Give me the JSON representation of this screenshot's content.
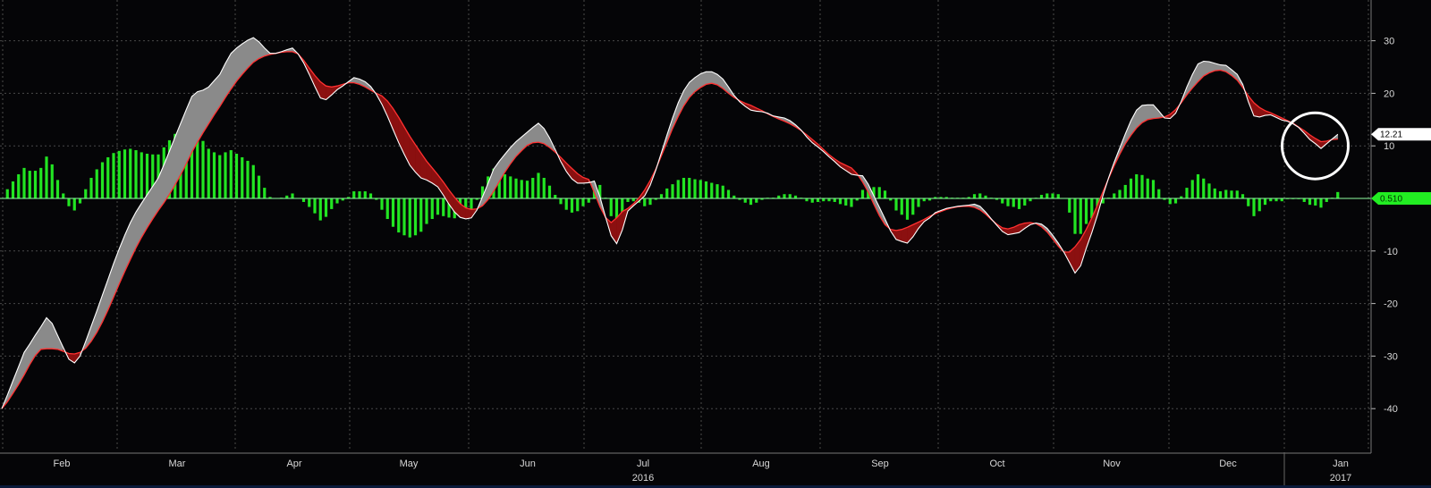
{
  "chart_data": {
    "type": "line",
    "title": "",
    "xlabel": "",
    "ylabel": "",
    "ylim": [
      -48,
      38
    ],
    "grid": true,
    "y_ticks": [
      30,
      20,
      10,
      -10,
      -20,
      -30,
      -40
    ],
    "months": [
      "Feb",
      "Mar",
      "Apr",
      "May",
      "Jun",
      "Jul",
      "Aug",
      "Sep",
      "Oct",
      "Nov",
      "Dec",
      "Jan"
    ],
    "years": [
      {
        "label": "2016",
        "month_index": 5
      },
      {
        "label": "2017",
        "month_index": 11
      }
    ],
    "last_value_tags": [
      {
        "label": "12.21",
        "value": 12.21,
        "color": "#ffffff",
        "text_color": "#000000"
      },
      {
        "label": "0.510",
        "value": 0,
        "color": "#22ee22",
        "text_color": "#003300"
      }
    ],
    "colors": {
      "fast_line": "#ffffff",
      "slow_line": "#ff3030",
      "fill_up": "#8a8a8a",
      "fill_down": "#8b1010",
      "histogram": "#22e522",
      "grid": "#4a4a4a",
      "axis_text": "#d8d8d8",
      "annotation_circle": "#ffffff"
    },
    "annotation": {
      "shape": "circle",
      "x_index": 234,
      "value": 10
    },
    "series": [
      {
        "role": "fast",
        "values": [
          -40.0,
          -37.4,
          -34.7,
          -32.0,
          -29.3,
          -27.7,
          -26.0,
          -24.4,
          -22.7,
          -23.8,
          -26.1,
          -28.4,
          -30.6,
          -31.3,
          -30.0,
          -27.2,
          -24.3,
          -21.4,
          -18.4,
          -15.4,
          -12.4,
          -9.6,
          -7.0,
          -4.6,
          -2.6,
          -0.9,
          0.7,
          2.3,
          3.9,
          6.4,
          9.0,
          11.7,
          14.3,
          16.9,
          19.4,
          20.3,
          20.6,
          21.2,
          22.4,
          23.6,
          25.7,
          27.6,
          28.6,
          29.4,
          30.1,
          30.6,
          29.8,
          28.6,
          27.6,
          27.6,
          27.9,
          28.3,
          28.6,
          27.5,
          25.8,
          23.6,
          21.3,
          19.1,
          18.8,
          19.7,
          20.7,
          21.4,
          22.2,
          23.0,
          22.7,
          22.2,
          21.3,
          19.8,
          17.9,
          15.6,
          13.1,
          10.6,
          8.4,
          6.3,
          5.0,
          3.9,
          3.5,
          2.9,
          2.2,
          0.6,
          -1.1,
          -2.6,
          -3.6,
          -3.9,
          -3.7,
          -2.2,
          0.3,
          2.9,
          5.6,
          7.1,
          8.4,
          9.7,
          10.8,
          11.7,
          12.6,
          13.5,
          14.3,
          13.3,
          11.5,
          9.3,
          7.0,
          5.1,
          3.7,
          2.9,
          2.9,
          3.0,
          3.3,
          0.3,
          -3.5,
          -7.1,
          -8.6,
          -6.0,
          -2.4,
          -1.4,
          -0.5,
          0.5,
          2.5,
          5.4,
          8.7,
          12.1,
          15.3,
          18.2,
          20.5,
          22.1,
          23.0,
          23.7,
          24.1,
          24.1,
          23.6,
          22.7,
          21.2,
          19.6,
          18.4,
          17.5,
          16.8,
          16.6,
          16.5,
          16.2,
          15.7,
          15.5,
          15.3,
          14.8,
          14.0,
          13.0,
          11.7,
          10.6,
          9.8,
          8.9,
          7.9,
          7.0,
          6.0,
          5.3,
          4.6,
          4.4,
          4.3,
          2.7,
          0.5,
          -1.7,
          -3.9,
          -6.2,
          -7.8,
          -8.2,
          -8.5,
          -7.3,
          -5.7,
          -4.4,
          -3.7,
          -2.7,
          -2.3,
          -1.9,
          -1.7,
          -1.5,
          -1.4,
          -1.3,
          -1.1,
          -1.5,
          -2.6,
          -3.9,
          -5.1,
          -6.3,
          -6.9,
          -6.7,
          -6.5,
          -5.7,
          -5.0,
          -4.7,
          -4.9,
          -5.7,
          -7.0,
          -8.5,
          -10.2,
          -12.2,
          -14.2,
          -12.8,
          -9.5,
          -6.5,
          -3.2,
          0.6,
          3.9,
          6.9,
          9.6,
          12.3,
          14.8,
          16.8,
          17.7,
          17.8,
          17.8,
          16.6,
          15.3,
          15.2,
          16.2,
          18.5,
          21.2,
          23.6,
          25.6,
          26.1,
          26.0,
          25.7,
          25.4,
          25.3,
          24.5,
          23.6,
          21.7,
          18.4,
          15.7,
          15.5,
          15.8,
          15.9,
          15.4,
          14.9,
          14.7,
          14.2,
          13.5,
          12.4,
          11.2,
          10.4,
          9.5,
          10.4,
          11.3,
          12.2
        ]
      },
      {
        "role": "slow",
        "values": [
          -40.0,
          -38.7,
          -37.1,
          -35.4,
          -33.6,
          -31.6,
          -29.9,
          -28.7,
          -28.6,
          -28.6,
          -28.7,
          -29.1,
          -29.5,
          -29.6,
          -29.3,
          -28.5,
          -27.2,
          -25.5,
          -23.5,
          -21.2,
          -18.8,
          -16.3,
          -13.9,
          -11.6,
          -9.4,
          -7.4,
          -5.6,
          -3.9,
          -2.3,
          -0.8,
          0.8,
          2.6,
          4.5,
          6.6,
          8.8,
          10.7,
          12.5,
          14.2,
          15.9,
          17.5,
          19.2,
          20.8,
          22.3,
          23.6,
          24.8,
          25.9,
          26.6,
          27.1,
          27.4,
          27.6,
          27.8,
          27.9,
          27.9,
          27.5,
          26.3,
          24.8,
          23.4,
          22.2,
          21.4,
          21.2,
          21.4,
          21.7,
          22.0,
          22.0,
          21.7,
          21.2,
          20.6,
          20.0,
          19.5,
          18.5,
          17.1,
          15.4,
          13.6,
          11.8,
          10.2,
          8.6,
          7.1,
          5.8,
          4.5,
          3.1,
          1.6,
          0.2,
          -1.0,
          -1.8,
          -2.1,
          -2.0,
          -1.4,
          -0.2,
          1.4,
          3.2,
          5.0,
          6.6,
          8.0,
          9.1,
          10.1,
          10.6,
          10.7,
          10.4,
          9.7,
          8.8,
          7.8,
          6.7,
          5.7,
          4.7,
          4.0,
          3.6,
          1.1,
          -1.6,
          -3.6,
          -4.6,
          -3.7,
          -2.5,
          -1.9,
          -1.0,
          0.1,
          1.6,
          3.4,
          5.6,
          8.1,
          10.7,
          13.3,
          15.6,
          17.6,
          19.2,
          20.3,
          21.1,
          21.7,
          21.9,
          21.6,
          20.9,
          20.0,
          19.2,
          18.6,
          18.1,
          17.7,
          17.2,
          16.7,
          16.1,
          15.6,
          15.1,
          14.7,
          14.2,
          13.6,
          12.9,
          12.1,
          11.2,
          10.3,
          9.3,
          8.3,
          7.5,
          6.8,
          6.3,
          5.8,
          4.7,
          3.1,
          1.2,
          -1.1,
          -3.3,
          -5.0,
          -5.9,
          -6.1,
          -5.9,
          -5.5,
          -5.0,
          -4.5,
          -4.0,
          -3.4,
          -2.9,
          -2.5,
          -2.1,
          -1.8,
          -1.6,
          -1.5,
          -1.5,
          -1.7,
          -2.2,
          -3.0,
          -4.0,
          -4.9,
          -5.6,
          -5.8,
          -5.5,
          -5.0,
          -4.7,
          -4.6,
          -4.8,
          -5.4,
          -6.4,
          -7.7,
          -9.1,
          -10.2,
          -10.2,
          -9.2,
          -7.8,
          -5.9,
          -3.7,
          -1.3,
          1.3,
          3.8,
          6.2,
          8.4,
          10.4,
          12.0,
          13.4,
          14.4,
          15.0,
          15.2,
          15.3,
          15.5,
          16.0,
          16.9,
          18.2,
          19.7,
          21.0,
          22.2,
          23.3,
          23.9,
          24.3,
          24.4,
          24.1,
          23.4,
          22.5,
          21.1,
          19.5,
          18.2,
          17.3,
          16.7,
          16.3,
          15.8,
          15.3,
          14.8,
          14.3,
          13.6,
          12.9,
          12.1,
          11.4,
          10.8,
          10.9,
          11.2,
          11.3
        ]
      }
    ]
  }
}
